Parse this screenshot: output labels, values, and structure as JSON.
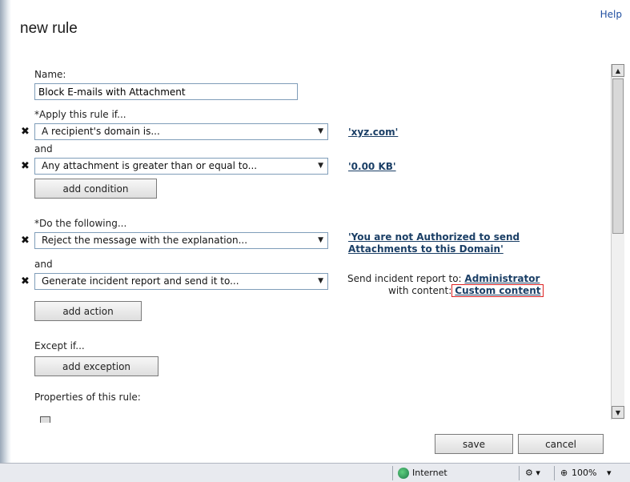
{
  "header": {
    "title": "new rule",
    "help_label": "Help"
  },
  "form": {
    "name_label": "Name:",
    "name_value": "Block E-mails with Attachment",
    "apply_label": "*Apply this rule if...",
    "conditions": [
      {
        "selected": "A recipient's domain is...",
        "value": "'xyz.com'"
      },
      {
        "selected": "Any attachment is greater than or equal to...",
        "value": "'0.00 KB'"
      }
    ],
    "and_label": "and",
    "add_condition_label": "add condition",
    "do_label": "*Do the following...",
    "actions": [
      {
        "selected": "Reject the message with the explanation...",
        "value": "'You are not Authorized to send Attachments to this Domain'"
      },
      {
        "selected": "Generate incident report and send it to..."
      }
    ],
    "incident": {
      "send_to_label": "Send incident report to:",
      "send_to_value": "Administrator",
      "content_label": "with content:",
      "content_value": "Custom content"
    },
    "add_action_label": "add action",
    "except_label": "Except if...",
    "add_exception_label": "add exception",
    "properties_label": "Properties of this rule:"
  },
  "footer": {
    "save_label": "save",
    "cancel_label": "cancel"
  },
  "status_bar": {
    "zone": "Internet",
    "zoom": "100%"
  },
  "colors": {
    "link": "#1b3f66",
    "highlight_border": "#dd2222",
    "help_link": "#1f4ea0"
  }
}
